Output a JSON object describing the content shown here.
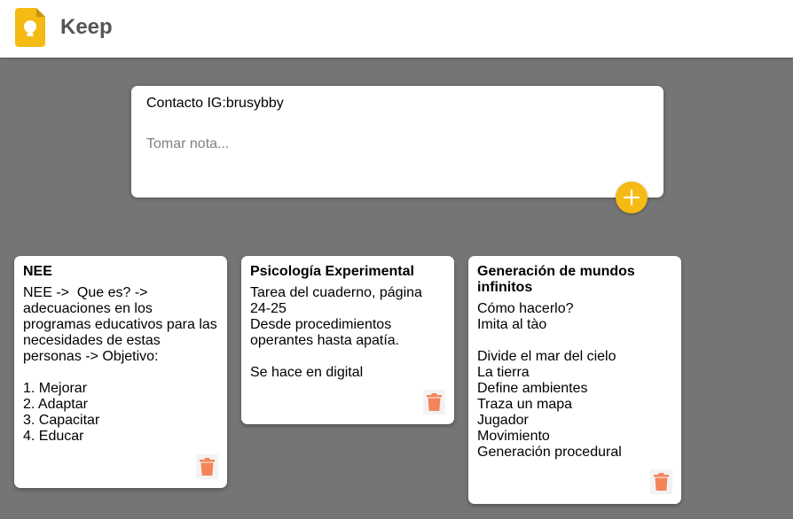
{
  "app": {
    "title": "Keep",
    "logo_icon": "keep-bulb-icon",
    "accent_color": "#f5ba13",
    "logo_color": "#f5ba13"
  },
  "create_note": {
    "title_value": "Contacto IG:brusybby",
    "content_placeholder": "Tomar nota...",
    "add_icon": "plus-icon"
  },
  "notes": [
    {
      "title": "NEE",
      "content": "NEE ->  Que es? -> adecuaciones en los programas educativos para las necesidades de estas personas -> Objetivo:\n\n1. Mejorar\n2. Adaptar\n3. Capacitar\n4. Educar",
      "delete_icon": "trash-icon"
    },
    {
      "title": "Psicología Experimental",
      "content": "Tarea del cuaderno, página 24-25\nDesde procedimientos operantes hasta apatía.\n\nSe hace en digital",
      "delete_icon": "trash-icon"
    },
    {
      "title": "Generación de mundos infinitos",
      "content": "Cómo hacerlo?\nImita al tào\n\nDivide el mar del cielo\nLa tierra\nDefine ambientes\nTraza un mapa\nJugador\nMovimiento\nGeneración procedural",
      "delete_icon": "trash-icon"
    }
  ],
  "colors": {
    "background": "#757575",
    "delete_icon": "#f4845a"
  }
}
